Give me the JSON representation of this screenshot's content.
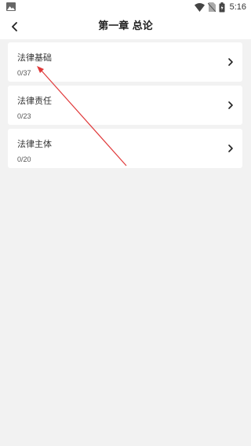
{
  "status_bar": {
    "left_icon": "image-icon",
    "icons": [
      "wifi-icon",
      "no-sim-icon",
      "battery-icon"
    ],
    "time": "5:16"
  },
  "nav": {
    "back_icon": "chevron-left-icon",
    "title": "第一章 总论"
  },
  "items": [
    {
      "title": "法律基础",
      "count": "0/37"
    },
    {
      "title": "法律责任",
      "count": "0/23"
    },
    {
      "title": "法律主体",
      "count": "0/20"
    }
  ],
  "colors": {
    "annotation_arrow": "#e0393a",
    "background": "#f2f2f2",
    "card": "#ffffff"
  }
}
